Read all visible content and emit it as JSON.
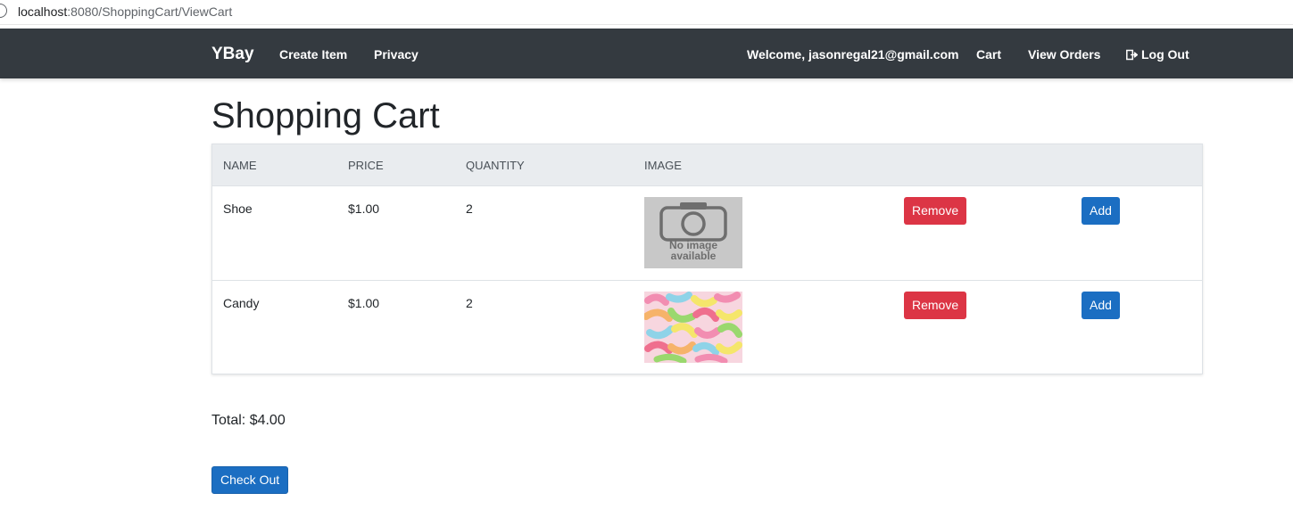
{
  "browser": {
    "url_host": "localhost",
    "url_rest": ":8080/ShoppingCart/ViewCart"
  },
  "navbar": {
    "brand": "YBay",
    "create_item": "Create Item",
    "privacy": "Privacy",
    "welcome": "Welcome, jasonregal21@gmail.com",
    "cart": "Cart",
    "view_orders": "View Orders",
    "logout": "Log Out",
    "logout_icon": "logout-icon",
    "bg_color": "#343a40"
  },
  "page": {
    "title": "Shopping Cart"
  },
  "table": {
    "headers": [
      "Name",
      "Price",
      "Quantity",
      "Image"
    ],
    "rows": [
      {
        "name": "Shoe",
        "price": "$1.00",
        "quantity": "2",
        "image": "no-image-placeholder",
        "placeholder_text_1": "No image",
        "placeholder_text_2": "available",
        "remove_label": "Remove",
        "add_label": "Add"
      },
      {
        "name": "Candy",
        "price": "$1.00",
        "quantity": "2",
        "image": "gummy-worms-photo",
        "remove_label": "Remove",
        "add_label": "Add"
      }
    ]
  },
  "summary": {
    "total": "Total: $4.00",
    "checkout_label": "Check Out"
  },
  "colors": {
    "remove": "#dc3545",
    "primary": "#1b6ec2",
    "header_bg": "#e9ecef"
  }
}
